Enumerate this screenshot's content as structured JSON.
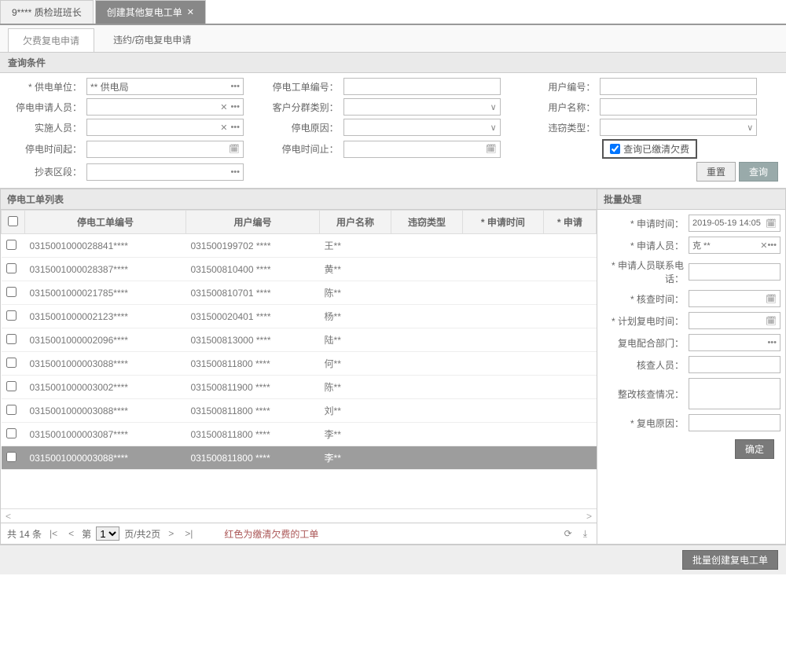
{
  "top_tabs": {
    "tab1": "9**** 质检班班长",
    "tab2": "创建其他复电工单"
  },
  "sub_tabs": {
    "tab1": "欠费复电申请",
    "tab2": "违约/窃电复电申请"
  },
  "section_search": "查询条件",
  "search": {
    "supply_unit_label": "* 供电单位：",
    "supply_unit_value": "** 供电局",
    "order_no_label": "停电工单编号：",
    "user_no_label": "用户编号：",
    "applicant_label": "停电申请人员：",
    "cust_group_label": "客户分群类别：",
    "user_name_label": "用户名称：",
    "impl_person_label": "实施人员：",
    "reason_label": "停电原因：",
    "steal_type_label": "违窃类型：",
    "time_start_label": "停电时间起：",
    "time_end_label": "停电时间止：",
    "check_paid_label": "查询已缴清欠费",
    "meter_section_label": "抄表区段：",
    "btn_reset": "重置",
    "btn_search": "查询"
  },
  "section_list": "停电工单列表",
  "table": {
    "cols": {
      "order_no": "停电工单编号",
      "user_no": "用户编号",
      "user_name": "用户名称",
      "steal_type": "违窃类型",
      "apply_time": "* 申请时间",
      "applicant": "* 申请"
    },
    "rows": [
      {
        "order": "0315001000028841****",
        "user": "031500199702 ****",
        "name": "王**"
      },
      {
        "order": "0315001000028387****",
        "user": "031500810400 ****",
        "name": "黄**"
      },
      {
        "order": "0315001000021785****",
        "user": "031500810701 ****",
        "name": "陈**"
      },
      {
        "order": "0315001000002123****",
        "user": "031500020401 ****",
        "name": "杨**"
      },
      {
        "order": "0315001000002096****",
        "user": "031500813000 ****",
        "name": "陆**"
      },
      {
        "order": "0315001000003088****",
        "user": "031500811800 ****",
        "name": "何**"
      },
      {
        "order": "0315001000003002****",
        "user": "031500811900 ****",
        "name": "陈**"
      },
      {
        "order": "0315001000003088****",
        "user": "031500811800 ****",
        "name": "刘**"
      },
      {
        "order": "0315001000003087****",
        "user": "031500811800 ****",
        "name": "李**"
      },
      {
        "order": "0315001000003088****",
        "user": "031500811800 ****",
        "name": "李**"
      }
    ]
  },
  "pager": {
    "total": "共 14 条",
    "page_label_pre": "第",
    "page_sel": "1",
    "page_label_post": "页/共2页",
    "hint": "红色为缴清欠费的工单"
  },
  "section_batch": "批量处理",
  "batch": {
    "apply_time_label": "* 申请时间：",
    "apply_time_value": "2019-05-19 14:05",
    "applicant_label": "* 申请人员：",
    "applicant_value": "克 **",
    "applicant_tel_label": "* 申请人员联系电话：",
    "check_time_label": "* 核查时间：",
    "plan_time_label": "* 计划复电时间：",
    "coop_dept_label": "复电配合部门：",
    "checker_label": "核查人员：",
    "rectify_label": "整改核查情况：",
    "reason_label": "* 复电原因：",
    "confirm": "确定"
  },
  "footer_btn": "批量创建复电工单"
}
